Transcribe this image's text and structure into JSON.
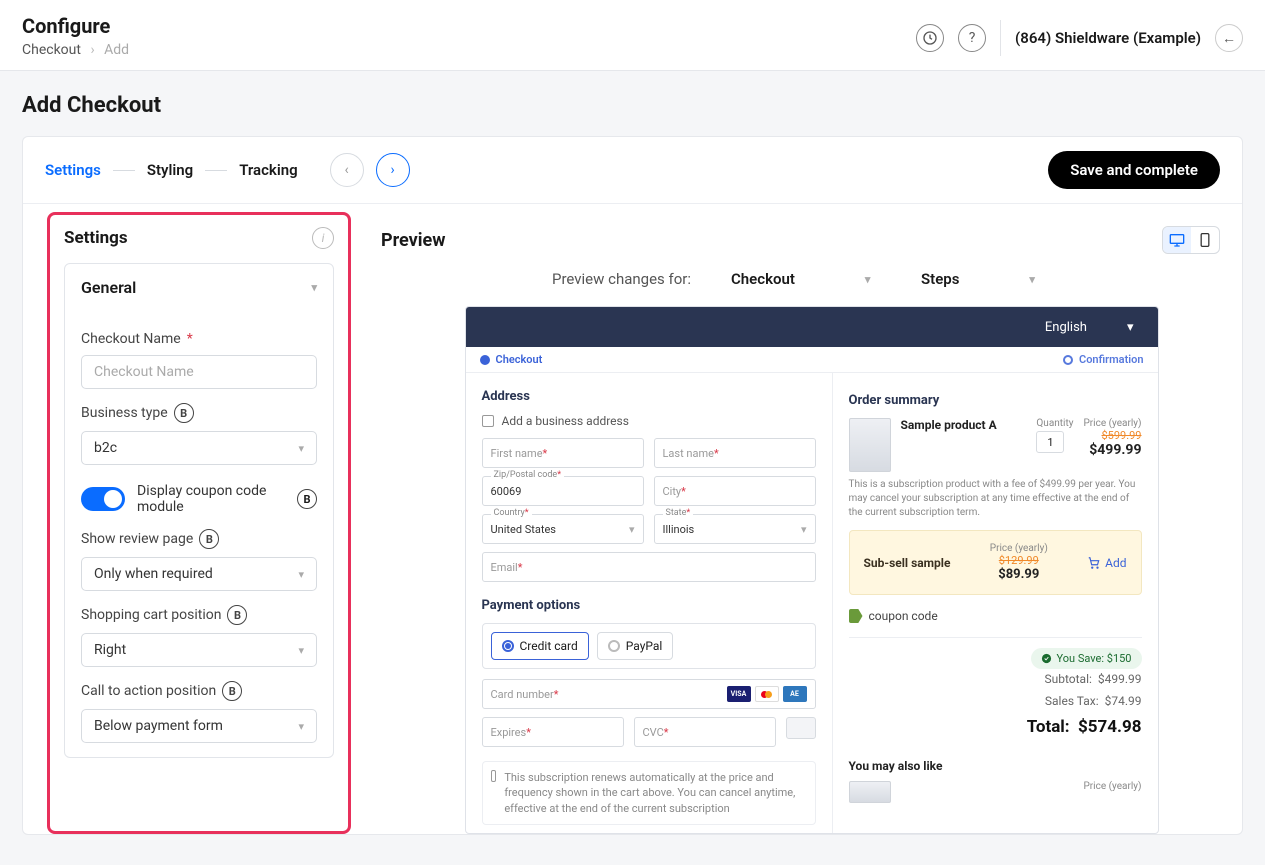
{
  "header": {
    "title": "Configure",
    "breadcrumb": {
      "root": "Checkout",
      "current": "Add"
    },
    "org": "(864) Shieldware (Example)"
  },
  "page": {
    "title": "Add Checkout"
  },
  "tabs": {
    "settings": "Settings",
    "styling": "Styling",
    "tracking": "Tracking"
  },
  "actions": {
    "save": "Save and complete"
  },
  "settings_panel": {
    "heading": "Settings",
    "section": "General",
    "checkout_name_label": "Checkout Name",
    "checkout_name_placeholder": "Checkout Name",
    "business_type_label": "Business type",
    "business_type_value": "b2c",
    "coupon_toggle_label": "Display coupon code module",
    "review_label": "Show review page",
    "review_value": "Only when required",
    "cart_pos_label": "Shopping cart position",
    "cart_pos_value": "Right",
    "cta_pos_label": "Call to action position",
    "cta_pos_value": "Below payment form"
  },
  "preview": {
    "heading": "Preview",
    "changes_for_label": "Preview changes for:",
    "changes_for_value": "Checkout",
    "steps_label": "Steps",
    "language": "English",
    "step_checkout": "Checkout",
    "step_confirmation": "Confirmation",
    "address": {
      "heading": "Address",
      "add_business": "Add a business address",
      "first_name": "First name",
      "last_name": "Last name",
      "zip_label": "Zip/Postal code",
      "zip_value": "60069",
      "city": "City",
      "country_label": "Country",
      "country_value": "United States",
      "state_label": "State",
      "state_value": "Illinois",
      "email": "Email"
    },
    "payment": {
      "heading": "Payment options",
      "credit_card": "Credit card",
      "paypal": "PayPal",
      "card_number": "Card number",
      "expires": "Expires",
      "cvc": "CVC"
    },
    "sub_note": "This subscription renews automatically at the price and frequency shown in the cart above. You can cancel anytime, effective at the end of the current subscription",
    "order": {
      "heading": "Order summary",
      "product_name": "Sample product A",
      "quantity_label": "Quantity",
      "quantity_value": "1",
      "price_label": "Price (yearly)",
      "price_old": "$599.99",
      "price_new": "$499.99",
      "desc": "This is a subscription product with a fee of $499.99 per year. You may cancel your subscription at any time effective at the end of the current subscription term.",
      "subsell_name": "Sub-sell sample",
      "subsell_price_label": "Price (yearly)",
      "subsell_old": "$129.99",
      "subsell_new": "$89.99",
      "add": "Add",
      "coupon": "coupon code",
      "you_save": "You Save: $150",
      "subtotal_label": "Subtotal:",
      "subtotal": "$499.99",
      "tax_label": "Sales Tax:",
      "tax": "$74.99",
      "total_label": "Total:",
      "total": "$574.98",
      "may_like": "You may also like",
      "price_label2": "Price (yearly)"
    }
  }
}
